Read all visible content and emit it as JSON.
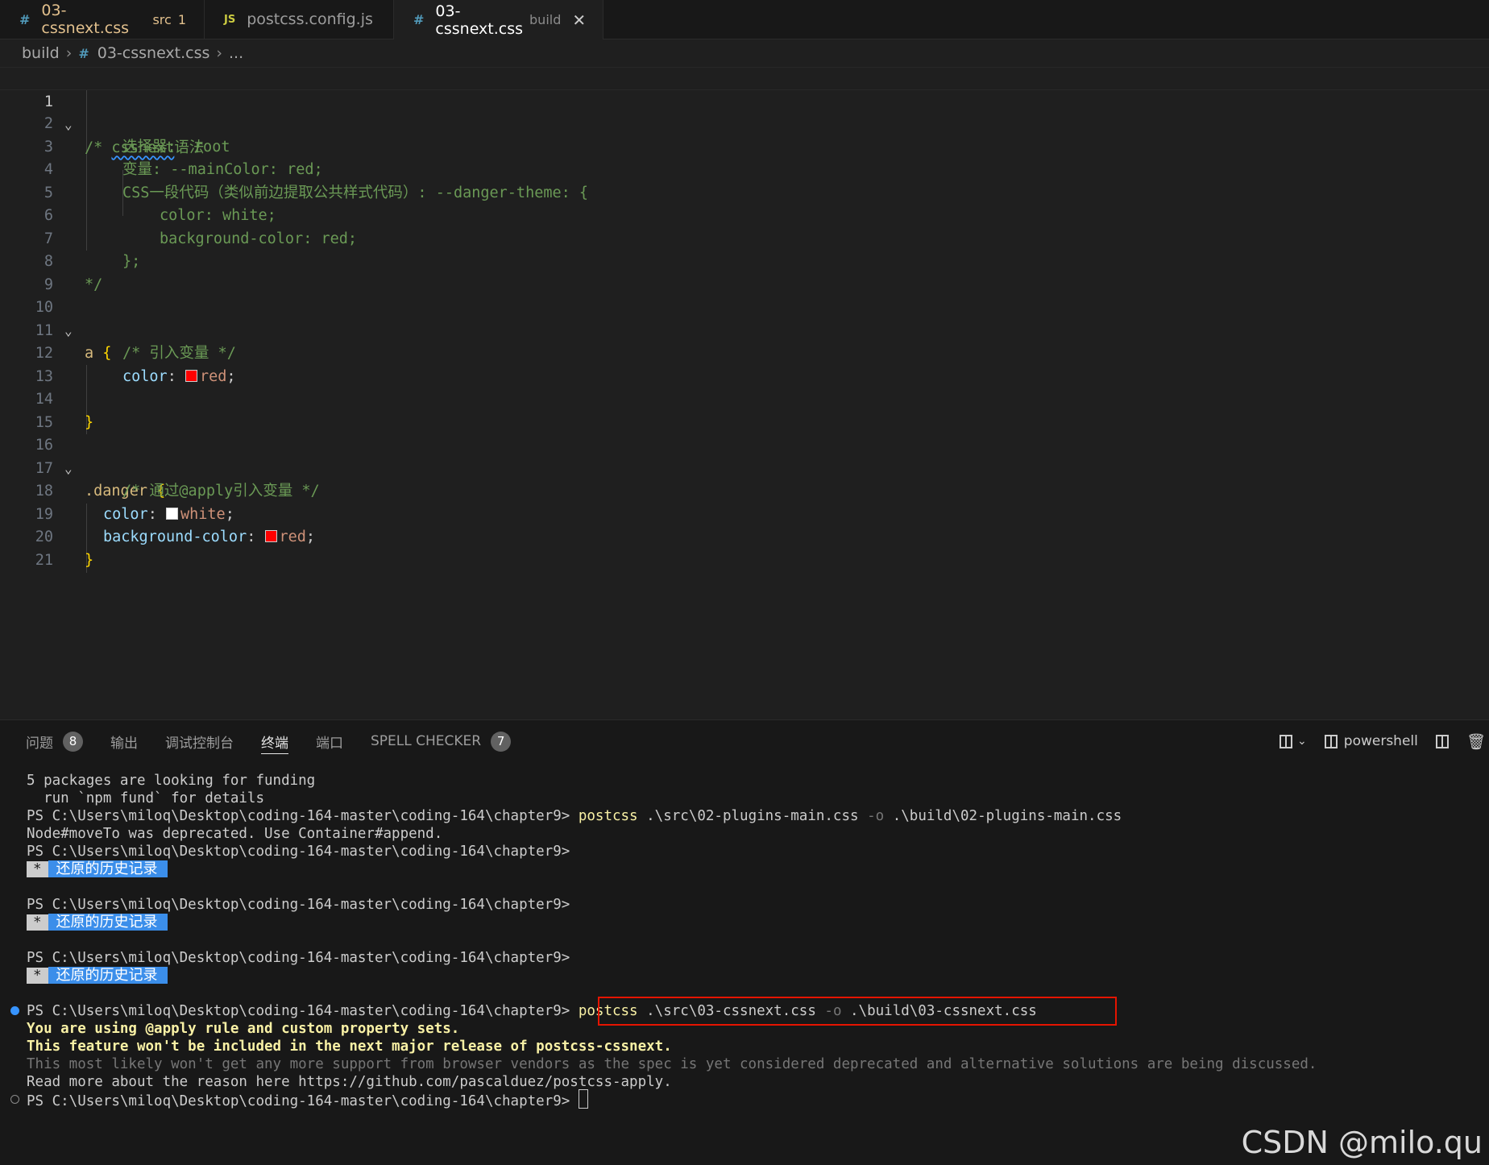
{
  "tabs": [
    {
      "icon": "#",
      "name": "03-cssnext.css",
      "desc": "src",
      "count": "1"
    },
    {
      "icon": "JS",
      "name": "postcss.config.js",
      "desc": "",
      "count": ""
    },
    {
      "icon": "#",
      "name": "03-cssnext.css",
      "desc": "build",
      "close": "✕"
    }
  ],
  "breadcrumb": {
    "folder": "build",
    "file": "03-cssnext.css",
    "tail": "..."
  },
  "editor": {
    "line_numbers": [
      "1",
      "2",
      "3",
      "4",
      "5",
      "6",
      "7",
      "8",
      "9",
      "10",
      "11",
      "12",
      "13",
      "14",
      "15",
      "16",
      "17",
      "18",
      "19",
      "20",
      "21"
    ],
    "lines": {
      "l1_a": "/* ",
      "l1_b": "cssnext",
      "l1_c": "语法",
      "l2": "选择器:  root",
      "l3": "变量: --mainColor: red;",
      "l4": "CSS一段代码（类似前边提取公共样式代码）: --danger-theme: {",
      "l5": "color: white;",
      "l6": "background-color: red;",
      "l7": "};",
      "l8": "*/",
      "l10_sel": "a",
      "l10_brace": "{",
      "l11": "/* 引入变量 */",
      "l12_prop": "color",
      "l12_colon": ": ",
      "l12_val": "red",
      "l12_semi": ";",
      "l14": "}",
      "l16_sel": ".danger",
      "l16_brace": "{",
      "l17": "/* 通过@apply引入变量 */",
      "l18_prop": "color",
      "l18_colon": ": ",
      "l18_val": "white",
      "l18_semi": ";",
      "l19_prop": "background-color",
      "l19_colon": ": ",
      "l19_val": "red",
      "l19_semi": ";",
      "l20": "}"
    },
    "swatch_colors": {
      "red": "#ff0000",
      "white": "#ffffff"
    }
  },
  "panel": {
    "tabs": [
      {
        "label": "问题",
        "badge": "8"
      },
      {
        "label": "输出"
      },
      {
        "label": "调试控制台"
      },
      {
        "label": "终端"
      },
      {
        "label": "端口"
      },
      {
        "label": "SPELL CHECKER",
        "badge": "7"
      }
    ],
    "shell": "powershell"
  },
  "terminal": {
    "prompt": "PS C:\\Users\\miloq\\Desktop\\coding-164-master\\coding-164\\chapter9>",
    "t1": "5 packages are looking for funding",
    "t2": "  run `npm fund` for details",
    "t3_cmd": "postcss",
    "t3_args": " .\\src\\02-plugins-main.css ",
    "t3_flag": "-o",
    "t3_out": " .\\build\\02-plugins-main.css",
    "t4": "Node#moveTo was deprecated. Use Container#append.",
    "restore_star": "*",
    "restore_label": "还原的历史记录",
    "t_cmd2_cmd": "postcss",
    "t_cmd2_args": " .\\src\\03-cssnext.css ",
    "t_cmd2_flag": "-o",
    "t_cmd2_out": " .\\build\\03-cssnext.css",
    "w1": "You are using @apply rule and custom property sets.",
    "w2": "This feature won't be included in the next major release of postcss-cssnext.",
    "w3": "This most likely won't get any more support from browser vendors as the spec is yet considered deprecated and alternative solutions are being discussed.",
    "w4": "Read more about the reason here https://github.com/pascalduez/postcss-apply."
  },
  "watermark": "CSDN @milo.qu"
}
